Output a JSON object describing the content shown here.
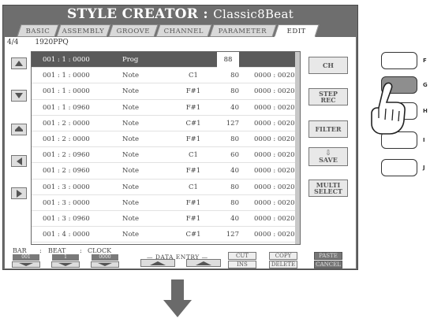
{
  "title": {
    "main": "STYLE CREATOR :",
    "style_name": "Classic8Beat"
  },
  "tabs": [
    {
      "label": "BASIC",
      "active": false
    },
    {
      "label": "ASSEMBLY",
      "active": false
    },
    {
      "label": "GROOVE",
      "active": false
    },
    {
      "label": "CHANNEL",
      "active": false
    },
    {
      "label": "PARAMETER",
      "active": false
    },
    {
      "label": "EDIT",
      "active": true
    }
  ],
  "meta": {
    "time_signature": "4/4",
    "resolution": "1920PPQ"
  },
  "events": [
    {
      "time": "001 : 1 : 0000",
      "type": "Prog",
      "data1": "",
      "data2": "88",
      "length": "",
      "selected": true
    },
    {
      "time": "001 : 1 : 0000",
      "type": "Note",
      "data1": "C1",
      "data2": "80",
      "length": "0000 : 0020",
      "selected": false
    },
    {
      "time": "001 : 1 : 0000",
      "type": "Note",
      "data1": "F#1",
      "data2": "80",
      "length": "0000 : 0020",
      "selected": false
    },
    {
      "time": "001 : 1 : 0960",
      "type": "Note",
      "data1": "F#1",
      "data2": "40",
      "length": "0000 : 0020",
      "selected": false
    },
    {
      "time": "001 : 2 : 0000",
      "type": "Note",
      "data1": "C#1",
      "data2": "127",
      "length": "0000 : 0020",
      "selected": false
    },
    {
      "time": "001 : 2 : 0000",
      "type": "Note",
      "data1": "F#1",
      "data2": "80",
      "length": "0000 : 0020",
      "selected": false
    },
    {
      "time": "001 : 2 : 0960",
      "type": "Note",
      "data1": "C1",
      "data2": "60",
      "length": "0000 : 0020",
      "selected": false
    },
    {
      "time": "001 : 2 : 0960",
      "type": "Note",
      "data1": "F#1",
      "data2": "40",
      "length": "0000 : 0020",
      "selected": false
    },
    {
      "time": "001 : 3 : 0000",
      "type": "Note",
      "data1": "C1",
      "data2": "80",
      "length": "0000 : 0020",
      "selected": false
    },
    {
      "time": "001 : 3 : 0000",
      "type": "Note",
      "data1": "F#1",
      "data2": "80",
      "length": "0000 : 0020",
      "selected": false
    },
    {
      "time": "001 : 3 : 0960",
      "type": "Note",
      "data1": "F#1",
      "data2": "40",
      "length": "0000 : 0020",
      "selected": false
    },
    {
      "time": "001 : 4 : 0000",
      "type": "Note",
      "data1": "C#1",
      "data2": "127",
      "length": "0000 : 0020",
      "selected": false
    }
  ],
  "side_buttons": [
    "double-up-arrow-icon",
    "up-arrow-icon",
    "double-up-arrow-icon",
    "left-arrow-icon",
    "right-arrow-icon"
  ],
  "right_buttons": {
    "ch": "CH",
    "step_rec": [
      "STEP",
      "REC"
    ],
    "filter": "FILTER",
    "save": "SAVE",
    "multi_select": [
      "MULTI",
      "SELECT"
    ]
  },
  "bottom": {
    "bar_label": "BAR",
    "beat_label": "BEAT",
    "clock_label": "CLOCK",
    "bar_value": "001",
    "beat_value": "1",
    "clock_value": "0000",
    "data_entry_label": "DATA ENTRY",
    "cut": "CUT",
    "ins": "INS",
    "copy": "COPY",
    "delete": "DELETE",
    "paste": "PASTE",
    "cancel": "CANCEL"
  },
  "physical_buttons": [
    {
      "label": "F",
      "pressed": false
    },
    {
      "label": "G",
      "pressed": true
    },
    {
      "label": "H",
      "pressed": false
    },
    {
      "label": "I",
      "pressed": false
    },
    {
      "label": "J",
      "pressed": false
    }
  ]
}
